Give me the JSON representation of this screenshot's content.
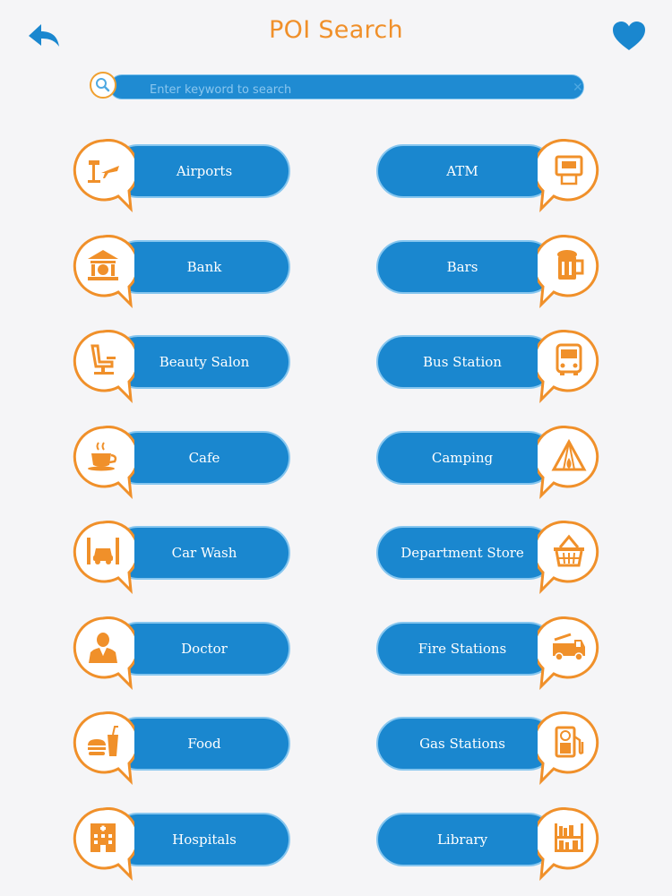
{
  "header": {
    "title": "POI Search",
    "back_icon": "back-arrow-icon",
    "favorite_icon": "heart-icon"
  },
  "search": {
    "placeholder": "Enter keyword to search",
    "value": "",
    "clear_glyph": "✕"
  },
  "colors": {
    "orange": "#f0902a",
    "blue": "#1a87cf",
    "pill_border": "#86c6ef",
    "background": "#f5f5f7"
  },
  "categories": [
    {
      "label": "Airports",
      "icon": "airport-icon"
    },
    {
      "label": "ATM",
      "icon": "atm-icon"
    },
    {
      "label": "Bank",
      "icon": "bank-icon"
    },
    {
      "label": "Bars",
      "icon": "beer-mug-icon"
    },
    {
      "label": "Beauty Salon",
      "icon": "salon-chair-icon"
    },
    {
      "label": "Bus Station",
      "icon": "bus-icon"
    },
    {
      "label": "Cafe",
      "icon": "coffee-cup-icon"
    },
    {
      "label": "Camping",
      "icon": "tent-icon"
    },
    {
      "label": "Car Wash",
      "icon": "car-wash-icon"
    },
    {
      "label": "Department Store",
      "icon": "shopping-basket-icon"
    },
    {
      "label": "Doctor",
      "icon": "doctor-icon"
    },
    {
      "label": "Fire Stations",
      "icon": "fire-truck-icon"
    },
    {
      "label": "Food",
      "icon": "burger-drink-icon"
    },
    {
      "label": "Gas Stations",
      "icon": "gas-pump-icon"
    },
    {
      "label": "Hospitals",
      "icon": "hospital-building-icon"
    },
    {
      "label": "Library",
      "icon": "bookshelf-icon"
    }
  ]
}
